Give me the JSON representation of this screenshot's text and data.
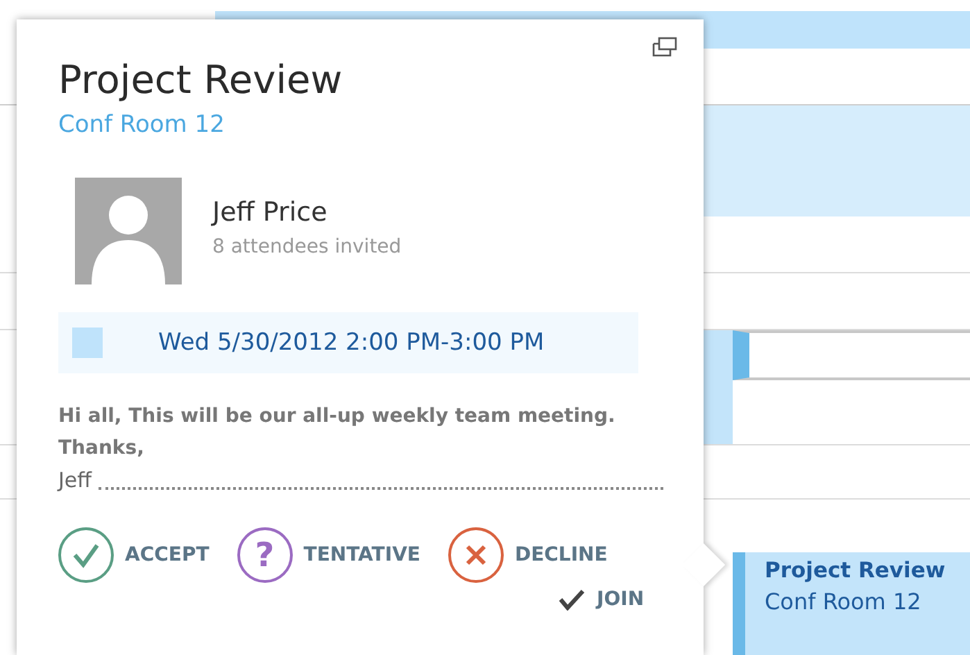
{
  "event_popup": {
    "title": "Project Review",
    "location": "Conf Room 12",
    "organizer": {
      "name": "Jeff Price",
      "attendees": "8 attendees invited"
    },
    "time": "Wed 5/30/2012 2:00 PM-3:00 PM",
    "message": [
      "Hi all, This will be our all-up weekly team meeting.",
      "Thanks,"
    ],
    "signature": "Jeff",
    "responses": [
      {
        "kind": "accept",
        "label": "ACCEPT"
      },
      {
        "kind": "tentative",
        "label": "TENTATIVE",
        "symbol": "?"
      },
      {
        "kind": "decline",
        "label": "DECLINE"
      }
    ],
    "join": {
      "label": "JOIN"
    }
  },
  "calendar_event": {
    "title": "Project Review",
    "location": "Conf Room 12"
  }
}
